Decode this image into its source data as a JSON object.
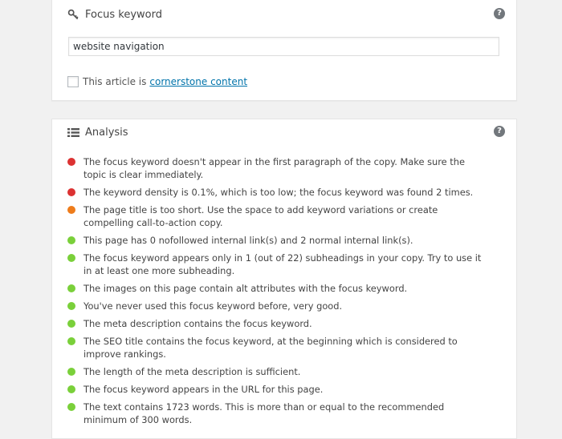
{
  "focus_panel": {
    "title": "Focus keyword",
    "help_label": "?",
    "keyword_value": "website navigation",
    "cornerstone_text": "This article is",
    "cornerstone_link": "cornerstone content"
  },
  "analysis_panel": {
    "title": "Analysis",
    "help_label": "?"
  },
  "colors": {
    "red": "#dc3232",
    "orange": "#ee7c1b",
    "green": "#7ad03a"
  },
  "results": [
    {
      "status": "red",
      "text": "The focus keyword doesn't appear in the first paragraph of the copy. Make sure the topic is clear immediately."
    },
    {
      "status": "red",
      "text": "The keyword density is 0.1%, which is too low; the focus keyword was found 2 times."
    },
    {
      "status": "orange",
      "text": "The page title is too short. Use the space to add keyword variations or create compelling call-to-action copy."
    },
    {
      "status": "green",
      "text": "This page has 0 nofollowed internal link(s) and 2 normal internal link(s)."
    },
    {
      "status": "green",
      "text": "The focus keyword appears only in 1 (out of 22) subheadings in your copy. Try to use it in at least one more subheading."
    },
    {
      "status": "green",
      "text": "The images on this page contain alt attributes with the focus keyword."
    },
    {
      "status": "green",
      "text": "You've never used this focus keyword before, very good."
    },
    {
      "status": "green",
      "text": "The meta description contains the focus keyword."
    },
    {
      "status": "green",
      "text": "The SEO title contains the focus keyword, at the beginning which is considered to improve rankings."
    },
    {
      "status": "green",
      "text": "The length of the meta description is sufficient."
    },
    {
      "status": "green",
      "text": "The focus keyword appears in the URL for this page."
    },
    {
      "status": "green",
      "text": "The text contains 1723 words. This is more than or equal to the recommended minimum of 300 words."
    }
  ]
}
